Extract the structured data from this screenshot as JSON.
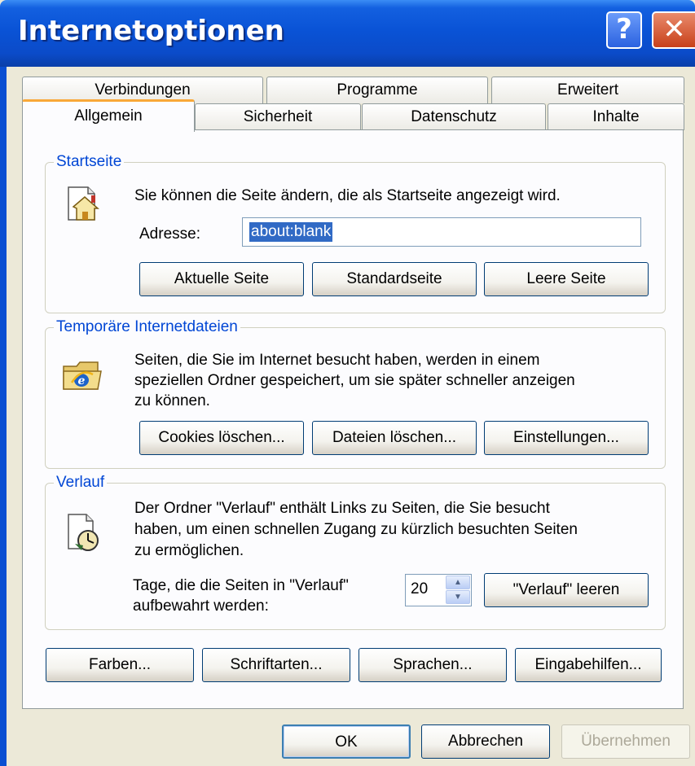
{
  "window": {
    "title": "Internetoptionen",
    "help_glyph": "?",
    "close_glyph": "✕"
  },
  "tabs_back": [
    {
      "label": "Verbindungen"
    },
    {
      "label": "Programme"
    },
    {
      "label": "Erweitert"
    }
  ],
  "tabs_front": [
    {
      "label": "Allgemein",
      "active": true
    },
    {
      "label": "Sicherheit"
    },
    {
      "label": "Datenschutz"
    },
    {
      "label": "Inhalte"
    }
  ],
  "startseite": {
    "legend": "Startseite",
    "description": "Sie können die Seite ändern, die als Startseite angezeigt wird.",
    "address_label": "Adresse:",
    "address_value": "about:blank",
    "buttons": {
      "current": "Aktuelle Seite",
      "standard": "Standardseite",
      "blank": "Leere Seite"
    }
  },
  "temp_files": {
    "legend": "Temporäre Internetdateien",
    "description_lines": [
      "Seiten, die Sie im Internet besucht haben, werden in einem",
      "speziellen Ordner gespeichert, um sie später schneller anzeigen",
      "zu können."
    ],
    "buttons": {
      "cookies": "Cookies löschen...",
      "files": "Dateien löschen...",
      "settings": "Einstellungen..."
    }
  },
  "history": {
    "legend": "Verlauf",
    "description_lines": [
      "Der Ordner \"Verlauf\" enthält Links zu Seiten, die Sie besucht",
      "haben, um einen schnellen Zugang zu kürzlich besuchten Seiten",
      "zu ermöglichen."
    ],
    "days_label_lines": [
      "Tage, die die Seiten in \"Verlauf\"",
      "aufbewahrt werden:"
    ],
    "days_value": "20",
    "clear_button": "\"Verlauf\" leeren"
  },
  "bottom_buttons": {
    "colors": "Farben...",
    "fonts": "Schriftarten...",
    "languages": "Sprachen...",
    "accessibility": "Eingabehilfen..."
  },
  "dialog_buttons": {
    "ok": "OK",
    "cancel": "Abbrechen",
    "apply": "Übernehmen"
  },
  "colors": {
    "titlebar": "#0A53D6",
    "dialog_bg": "#ECE9D8",
    "legend": "#0046D5",
    "active_tab_accent": "#F9A838",
    "selection": "#316AC5"
  },
  "icons": {
    "startseite": "home-page-icon",
    "temp_files": "ie-folder-icon",
    "history": "history-clock-icon",
    "spin_up": "▲",
    "spin_down": "▼"
  }
}
